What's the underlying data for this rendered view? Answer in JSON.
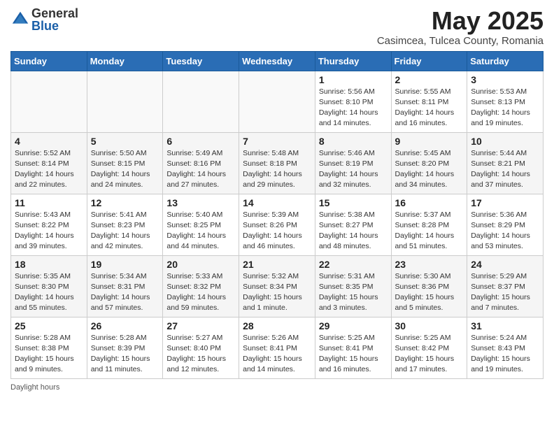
{
  "header": {
    "logo_general": "General",
    "logo_blue": "Blue",
    "month_title": "May 2025",
    "location": "Casimcea, Tulcea County, Romania"
  },
  "days_of_week": [
    "Sunday",
    "Monday",
    "Tuesday",
    "Wednesday",
    "Thursday",
    "Friday",
    "Saturday"
  ],
  "weeks": [
    [
      {
        "day": "",
        "info": ""
      },
      {
        "day": "",
        "info": ""
      },
      {
        "day": "",
        "info": ""
      },
      {
        "day": "",
        "info": ""
      },
      {
        "day": "1",
        "info": "Sunrise: 5:56 AM\nSunset: 8:10 PM\nDaylight: 14 hours\nand 14 minutes."
      },
      {
        "day": "2",
        "info": "Sunrise: 5:55 AM\nSunset: 8:11 PM\nDaylight: 14 hours\nand 16 minutes."
      },
      {
        "day": "3",
        "info": "Sunrise: 5:53 AM\nSunset: 8:13 PM\nDaylight: 14 hours\nand 19 minutes."
      }
    ],
    [
      {
        "day": "4",
        "info": "Sunrise: 5:52 AM\nSunset: 8:14 PM\nDaylight: 14 hours\nand 22 minutes."
      },
      {
        "day": "5",
        "info": "Sunrise: 5:50 AM\nSunset: 8:15 PM\nDaylight: 14 hours\nand 24 minutes."
      },
      {
        "day": "6",
        "info": "Sunrise: 5:49 AM\nSunset: 8:16 PM\nDaylight: 14 hours\nand 27 minutes."
      },
      {
        "day": "7",
        "info": "Sunrise: 5:48 AM\nSunset: 8:18 PM\nDaylight: 14 hours\nand 29 minutes."
      },
      {
        "day": "8",
        "info": "Sunrise: 5:46 AM\nSunset: 8:19 PM\nDaylight: 14 hours\nand 32 minutes."
      },
      {
        "day": "9",
        "info": "Sunrise: 5:45 AM\nSunset: 8:20 PM\nDaylight: 14 hours\nand 34 minutes."
      },
      {
        "day": "10",
        "info": "Sunrise: 5:44 AM\nSunset: 8:21 PM\nDaylight: 14 hours\nand 37 minutes."
      }
    ],
    [
      {
        "day": "11",
        "info": "Sunrise: 5:43 AM\nSunset: 8:22 PM\nDaylight: 14 hours\nand 39 minutes."
      },
      {
        "day": "12",
        "info": "Sunrise: 5:41 AM\nSunset: 8:23 PM\nDaylight: 14 hours\nand 42 minutes."
      },
      {
        "day": "13",
        "info": "Sunrise: 5:40 AM\nSunset: 8:25 PM\nDaylight: 14 hours\nand 44 minutes."
      },
      {
        "day": "14",
        "info": "Sunrise: 5:39 AM\nSunset: 8:26 PM\nDaylight: 14 hours\nand 46 minutes."
      },
      {
        "day": "15",
        "info": "Sunrise: 5:38 AM\nSunset: 8:27 PM\nDaylight: 14 hours\nand 48 minutes."
      },
      {
        "day": "16",
        "info": "Sunrise: 5:37 AM\nSunset: 8:28 PM\nDaylight: 14 hours\nand 51 minutes."
      },
      {
        "day": "17",
        "info": "Sunrise: 5:36 AM\nSunset: 8:29 PM\nDaylight: 14 hours\nand 53 minutes."
      }
    ],
    [
      {
        "day": "18",
        "info": "Sunrise: 5:35 AM\nSunset: 8:30 PM\nDaylight: 14 hours\nand 55 minutes."
      },
      {
        "day": "19",
        "info": "Sunrise: 5:34 AM\nSunset: 8:31 PM\nDaylight: 14 hours\nand 57 minutes."
      },
      {
        "day": "20",
        "info": "Sunrise: 5:33 AM\nSunset: 8:32 PM\nDaylight: 14 hours\nand 59 minutes."
      },
      {
        "day": "21",
        "info": "Sunrise: 5:32 AM\nSunset: 8:34 PM\nDaylight: 15 hours\nand 1 minute."
      },
      {
        "day": "22",
        "info": "Sunrise: 5:31 AM\nSunset: 8:35 PM\nDaylight: 15 hours\nand 3 minutes."
      },
      {
        "day": "23",
        "info": "Sunrise: 5:30 AM\nSunset: 8:36 PM\nDaylight: 15 hours\nand 5 minutes."
      },
      {
        "day": "24",
        "info": "Sunrise: 5:29 AM\nSunset: 8:37 PM\nDaylight: 15 hours\nand 7 minutes."
      }
    ],
    [
      {
        "day": "25",
        "info": "Sunrise: 5:28 AM\nSunset: 8:38 PM\nDaylight: 15 hours\nand 9 minutes."
      },
      {
        "day": "26",
        "info": "Sunrise: 5:28 AM\nSunset: 8:39 PM\nDaylight: 15 hours\nand 11 minutes."
      },
      {
        "day": "27",
        "info": "Sunrise: 5:27 AM\nSunset: 8:40 PM\nDaylight: 15 hours\nand 12 minutes."
      },
      {
        "day": "28",
        "info": "Sunrise: 5:26 AM\nSunset: 8:41 PM\nDaylight: 15 hours\nand 14 minutes."
      },
      {
        "day": "29",
        "info": "Sunrise: 5:25 AM\nSunset: 8:41 PM\nDaylight: 15 hours\nand 16 minutes."
      },
      {
        "day": "30",
        "info": "Sunrise: 5:25 AM\nSunset: 8:42 PM\nDaylight: 15 hours\nand 17 minutes."
      },
      {
        "day": "31",
        "info": "Sunrise: 5:24 AM\nSunset: 8:43 PM\nDaylight: 15 hours\nand 19 minutes."
      }
    ]
  ],
  "footer": {
    "daylight_hours": "Daylight hours"
  }
}
